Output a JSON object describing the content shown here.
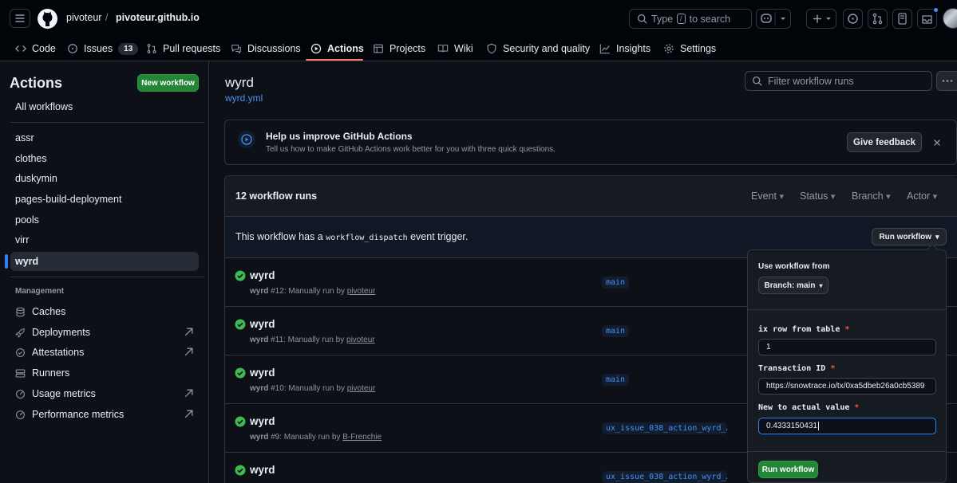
{
  "header": {
    "owner": "pivoteur",
    "separator": "/",
    "repo": "pivoteur.github.io",
    "search_type": "Type",
    "search_key": "/",
    "search_rest": "to search"
  },
  "repo_nav": {
    "tabs": [
      {
        "label": "Code",
        "icon": "code-icon"
      },
      {
        "label": "Issues",
        "icon": "issue-icon",
        "count": "13"
      },
      {
        "label": "Pull requests",
        "icon": "pull-request-icon"
      },
      {
        "label": "Discussions",
        "icon": "discussion-icon"
      },
      {
        "label": "Actions",
        "icon": "play-icon"
      },
      {
        "label": "Projects",
        "icon": "table-icon"
      },
      {
        "label": "Wiki",
        "icon": "book-icon"
      },
      {
        "label": "Security and quality",
        "icon": "shield-icon"
      },
      {
        "label": "Insights",
        "icon": "graph-icon"
      },
      {
        "label": "Settings",
        "icon": "gear-icon"
      }
    ],
    "active": "Actions"
  },
  "sidebar": {
    "title": "Actions",
    "new_workflow": "New workflow",
    "all_workflows": "All workflows",
    "workflows": [
      "assr",
      "clothes",
      "duskymin",
      "pages-build-deployment",
      "pools",
      "virr",
      "wyrd"
    ],
    "active_workflow": "wyrd",
    "management_title": "Management",
    "management": [
      {
        "label": "Caches",
        "icon": "database-icon"
      },
      {
        "label": "Deployments",
        "icon": "rocket-icon",
        "external": true
      },
      {
        "label": "Attestations",
        "icon": "verified-icon",
        "external": true
      },
      {
        "label": "Runners",
        "icon": "server-icon"
      },
      {
        "label": "Usage metrics",
        "icon": "meter-icon",
        "external": true
      },
      {
        "label": "Performance metrics",
        "icon": "meter-icon",
        "external": true
      }
    ]
  },
  "main": {
    "workflow_name": "wyrd",
    "workflow_file": "wyrd.yml",
    "filter_placeholder": "Filter workflow runs",
    "banner": {
      "title": "Help us improve GitHub Actions",
      "text": "Tell us how to make GitHub Actions work better for you with three quick questions.",
      "button": "Give feedback"
    },
    "runs_count": "12 workflow runs",
    "filters": [
      "Event",
      "Status",
      "Branch",
      "Actor"
    ],
    "dispatch": {
      "prefix": "This workflow has a",
      "code": "workflow_dispatch",
      "suffix": "event trigger.",
      "button": "Run workflow"
    },
    "runs": [
      {
        "title": "wyrd",
        "name": "wyrd",
        "number": "#12",
        "trigger": ": Manually run by",
        "actor": "pivoteur",
        "branch": "main"
      },
      {
        "title": "wyrd",
        "name": "wyrd",
        "number": "#11",
        "trigger": ": Manually run by",
        "actor": "pivoteur",
        "branch": "main"
      },
      {
        "title": "wyrd",
        "name": "wyrd",
        "number": "#10",
        "trigger": ": Manually run by",
        "actor": "pivoteur",
        "branch": "main"
      },
      {
        "title": "wyrd",
        "name": "wyrd",
        "number": "#9",
        "trigger": ": Manually run by",
        "actor": "B-Frenchie",
        "branch": "ux_issue_038_action_wyrd_…"
      },
      {
        "title": "wyrd",
        "name": "",
        "number": "",
        "trigger": "",
        "actor": "",
        "branch": "ux_issue_038_action_wyrd_…"
      }
    ]
  },
  "popup": {
    "use_from": "Use workflow from",
    "branch_button": "Branch: main",
    "fields": [
      {
        "label": "ix row from table",
        "value": "1"
      },
      {
        "label": "Transaction ID",
        "value": "https://snowtrace.io/tx/0xa5dbeb26a0cb5389"
      },
      {
        "label": "New to actual value",
        "value": "0.4333150431"
      }
    ],
    "required_mark": "*",
    "run_button": "Run workflow"
  },
  "colors": {
    "accent_blue": "#2f81f7",
    "success_green": "#3fb950",
    "button_green": "#238636",
    "active_tab_underline": "#f78166"
  }
}
